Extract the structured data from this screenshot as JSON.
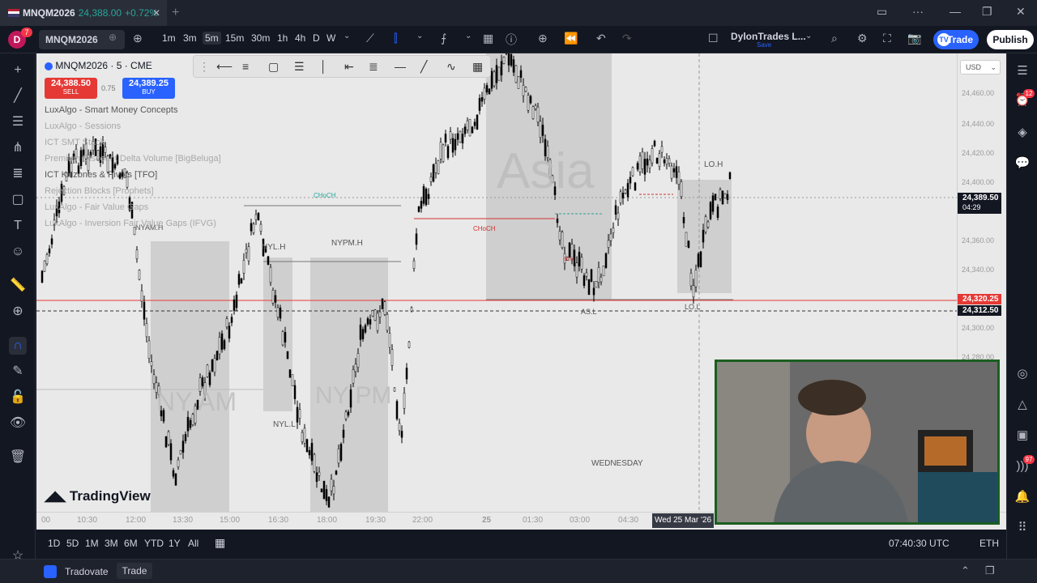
{
  "tab": {
    "title": "MNQM2026",
    "price": "24,388.00",
    "change": "+0.72%"
  },
  "toolbar": {
    "avatar_letter": "D",
    "avatar_badge": "7",
    "symbol": "MNQM2026",
    "intervals": [
      "1m",
      "3m",
      "5m",
      "15m",
      "30m",
      "1h",
      "4h",
      "D",
      "W"
    ],
    "active_interval": "5m",
    "layout_name": "DylonTrades L...",
    "layout_sub": "Save",
    "trade_label": "Trade",
    "publish_label": "Publish"
  },
  "legend": {
    "symbol_line": "MNQM2026 · 5 · CME",
    "sell_price": "24,388.50",
    "sell_label": "SELL",
    "spread": "0.75",
    "buy_price": "24,389.25",
    "buy_label": "BUY",
    "indicators": [
      "LuxAlgo - Smart Money Concepts",
      "LuxAlgo - Sessions",
      "ICT SMT Stack",
      "Premium Discount Delta Volume [BigBeluga]",
      "ICT Killzones & Pivots [TFO]",
      "Rejection Blocks [Prophets]",
      "LuxAlgo - Fair Value Gaps",
      "LuxAlgo - Inversion Fair Value Gaps (IFVG)"
    ]
  },
  "chart_labels": {
    "asia": "Asia",
    "nyam": "NY AM",
    "nypm": "NY PM",
    "wednesday": "WEDNESDAY",
    "lo_h": "LO.H",
    "lo_l": "LO.L",
    "as_l": "AS.L",
    "nyl_h": "NYL.H",
    "nyl_l": "NYL.L",
    "nypm_h": "NYPM.H",
    "nyam_h": "NYAM.H",
    "choch": "CHoCH",
    "bos": "BOS"
  },
  "price_axis": {
    "currency": "USD",
    "ticks": [
      "24,460.00",
      "24,440.00",
      "24,420.00",
      "24,400.00",
      "24,360.00",
      "24,340.00",
      "24,300.00",
      "24,280.00"
    ],
    "last_price": "24,389.50",
    "countdown": "04:29",
    "line_price": "24,320.25",
    "cross_price": "24,312.50",
    "up_color": "#ffffff",
    "down_color": "#000000"
  },
  "time_axis": {
    "ticks": [
      "00",
      "10:30",
      "12:00",
      "13:30",
      "15:00",
      "16:30",
      "18:00",
      "19:30",
      "22:00",
      "25",
      "01:30",
      "03:00",
      "04:30"
    ],
    "cross_date": "Wed 25 Mar '26"
  },
  "bottombar": {
    "ranges": [
      "1D",
      "5D",
      "1M",
      "3M",
      "6M",
      "YTD",
      "1Y",
      "All"
    ],
    "clock": "07:40:30 UTC",
    "session": "ETH"
  },
  "footer": {
    "broker": "Tradovate",
    "trade_tab": "Trade"
  },
  "badges": {
    "alerts": "12",
    "notifications": "97"
  },
  "watermark": "TradingView"
}
